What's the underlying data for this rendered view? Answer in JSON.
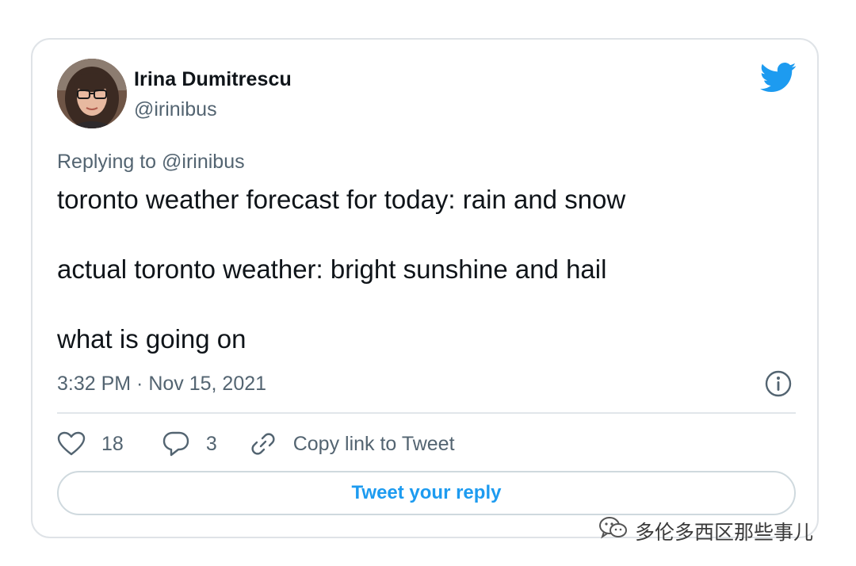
{
  "author": {
    "name": "Irina Dumitrescu",
    "handle": "@irinibus"
  },
  "reply_context": {
    "prefix": "Replying to",
    "mention": "@irinibus"
  },
  "tweet": {
    "lines": [
      "toronto weather forecast for today: rain and snow",
      "actual toronto weather: bright sunshine and hail",
      "what is going on"
    ],
    "timestamp": "3:32 PM · Nov 15, 2021"
  },
  "actions": {
    "like_count": "18",
    "reply_count": "3",
    "copy_link_label": "Copy link to Tweet"
  },
  "reply_button_label": "Tweet your reply",
  "watermark": "多伦多西区那些事儿",
  "icons": {
    "brand": "twitter-bird-icon",
    "info": "info-icon",
    "like": "heart-icon",
    "reply": "speech-bubble-icon",
    "copy": "link-icon",
    "watermark": "wechat-icon"
  },
  "colors": {
    "brand_blue": "#1d9bf0",
    "text_primary": "#0f1419",
    "text_secondary": "#536471",
    "border": "#dfe3e7"
  }
}
